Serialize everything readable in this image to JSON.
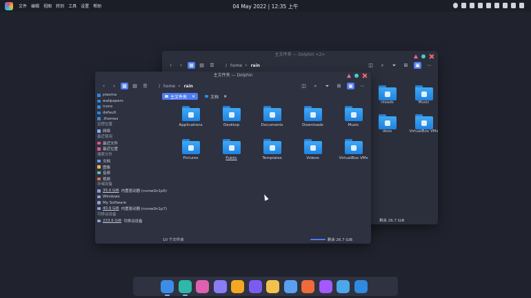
{
  "topbar": {
    "menu": [
      "文件",
      "编辑",
      "视图",
      "转到",
      "工具",
      "设置",
      "帮助"
    ],
    "clock": "04 May 2022 | 12:35 上午",
    "tray_icons": [
      "bell-icon",
      "clipboard-icon",
      "battery-icon",
      "device-icon",
      "keyboard-icon",
      "wifi-icon",
      "display-icon",
      "volume-icon",
      "chevron-down-icon"
    ]
  },
  "back_window": {
    "title": "主文件夹 — Dolphin <2>",
    "breadcrumb": [
      "/",
      "home",
      "rain"
    ],
    "items": [
      {
        "label": "nloads",
        "glyph": "download"
      },
      {
        "label": "Music",
        "glyph": "music"
      },
      {
        "label": "deos",
        "glyph": "video"
      },
      {
        "label": "VirtualBox VMs",
        "glyph": "box"
      }
    ],
    "status_free": "剩余 26.7 GiB"
  },
  "front_window": {
    "title": "主文件夹 — Dolphin",
    "breadcrumb": [
      "/",
      "home",
      "rain"
    ],
    "tabs": [
      {
        "label": "主文件夹",
        "active": true
      },
      {
        "label": "文档",
        "active": false
      }
    ],
    "sidebar": {
      "top_items": [
        "plasma",
        "wallpapers",
        "icons",
        "default",
        ".themes"
      ],
      "remote_head": "远程位置",
      "remote": [
        "网络"
      ],
      "recent_head": "最近使用",
      "recent": [
        "最近文件",
        "最近位置"
      ],
      "search_head": "搜索文件",
      "search": [
        "文档",
        "图像",
        "音频",
        "视频"
      ],
      "devices_head": "存储设备",
      "devices": [
        {
          "size": "35.0 GiB",
          "label": "内置驱动器 (nvme0n1p6)"
        },
        {
          "size": "",
          "label": "Windows"
        },
        {
          "size": "",
          "label": "My Software"
        },
        {
          "size": "40.9 GiB",
          "label": "内置驱动器 (nvme0n1p7)"
        }
      ],
      "removable_head": "可移动设备",
      "removable": [
        {
          "size": "223.6 GiB",
          "label": "可移动设备"
        }
      ]
    },
    "files": [
      {
        "label": "Applications",
        "glyph": "apps"
      },
      {
        "label": "Desktop",
        "glyph": "desktop"
      },
      {
        "label": "Documents",
        "glyph": "doc"
      },
      {
        "label": "Downloads",
        "glyph": "download"
      },
      {
        "label": "Music",
        "glyph": "music"
      },
      {
        "label": "Pictures",
        "glyph": "camera"
      },
      {
        "label": "Public",
        "glyph": "share"
      },
      {
        "label": "Templates",
        "glyph": "template"
      },
      {
        "label": "Videos",
        "glyph": "video"
      },
      {
        "label": "VirtualBox VMs",
        "glyph": "box"
      }
    ],
    "status_count": "10 个文件夹",
    "status_free": "剩余 26.7 GiB"
  },
  "dock": [
    {
      "name": "dolphin",
      "color": "#3d8de8",
      "running": true
    },
    {
      "name": "edge",
      "color": "#2fb8a8",
      "running": true
    },
    {
      "name": "cozy-music",
      "color": "#e060b0",
      "running": false
    },
    {
      "name": "settings",
      "color": "#8a7cf5",
      "running": false
    },
    {
      "name": "github-desktop",
      "color": "#f5a623",
      "running": false
    },
    {
      "name": "kate",
      "color": "#7b5cf0",
      "running": false
    },
    {
      "name": "chrome",
      "color": "#f2c14e",
      "running": false
    },
    {
      "name": "krita",
      "color": "#5aa0f2",
      "running": false
    },
    {
      "name": "firefox",
      "color": "#f06a3a",
      "running": false
    },
    {
      "name": "figma",
      "color": "#a259ff",
      "running": false
    },
    {
      "name": "notes",
      "color": "#4aa8e8",
      "running": false
    },
    {
      "name": "discover",
      "color": "#2f8ae0",
      "running": false
    }
  ]
}
